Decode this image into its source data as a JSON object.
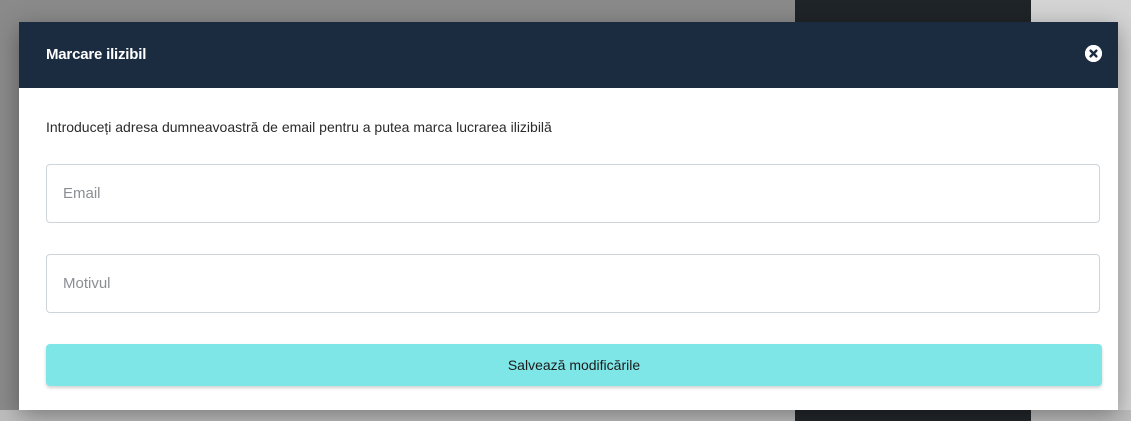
{
  "modal": {
    "title": "Marcare ilizibil",
    "close_icon": "close-circle-icon",
    "intro_text": "Introduceți adresa dumneavoastră de email pentru a putea marca lucrarea ilizibilă",
    "email_field": {
      "placeholder": "Email",
      "value": ""
    },
    "reason_field": {
      "placeholder": "Motivul",
      "value": ""
    },
    "save_label": "Salvează modificările"
  },
  "colors": {
    "header_bg": "#1c2c40",
    "save_button_bg": "#7fe6e8"
  }
}
